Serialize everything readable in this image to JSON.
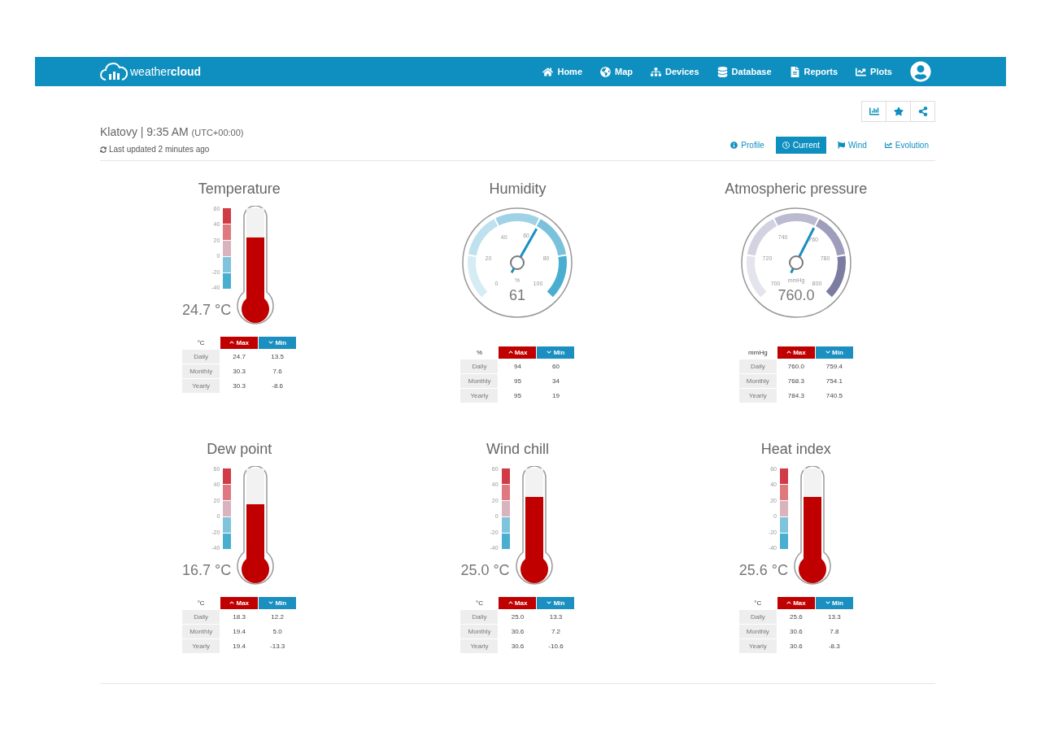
{
  "navbar": {
    "logo": "weather**cloud**",
    "items": [
      {
        "kind": "home",
        "label": "Home"
      },
      {
        "kind": "map",
        "label": "Map"
      },
      {
        "kind": "devices",
        "label": "Devices"
      },
      {
        "kind": "database",
        "label": "Database"
      },
      {
        "kind": "reports",
        "label": "Reports"
      },
      {
        "kind": "plots",
        "label": "Plots"
      }
    ]
  },
  "header": {
    "station": "Klatovy | 9:35 AM",
    "timezone": "(UTC+00:00)",
    "updated": "Last updated 2 minutes ago"
  },
  "toolbar": [
    {
      "kind": "chart"
    },
    {
      "kind": "star"
    },
    {
      "kind": "share"
    }
  ],
  "tabs": [
    {
      "kind": "info",
      "label": "Profile",
      "selected": false
    },
    {
      "kind": "clock",
      "label": "Current",
      "selected": true
    },
    {
      "kind": "flag",
      "label": "Wind",
      "selected": false
    },
    {
      "kind": "chart",
      "label": "Evolution",
      "selected": false
    }
  ],
  "widgets": [
    {
      "kind": "thermometer",
      "title": "Temperature",
      "scale": [
        "60",
        "40",
        "20",
        "0",
        "-20",
        "-40"
      ],
      "level": 0.647,
      "value": "24.7 °C",
      "unit": "°C",
      "max_label": "Max",
      "min_label": "Min",
      "rows": [
        {
          "period": "Daily",
          "max": "24.7",
          "min": "13.5"
        },
        {
          "period": "Monthly",
          "max": "30.3",
          "min": "7.6"
        },
        {
          "period": "Yearly",
          "max": "30.3",
          "min": "-8.6"
        }
      ]
    },
    {
      "kind": "gauge",
      "title": "Humidity",
      "scale": [
        "0",
        "20",
        "40",
        "60",
        "80",
        "100"
      ],
      "level": 0.61,
      "gauge_unit": "%",
      "value": "61",
      "unit": "%",
      "max_label": "Max",
      "min_label": "Min",
      "rows": [
        {
          "period": "Daily",
          "max": "94",
          "min": "60"
        },
        {
          "period": "Monthly",
          "max": "95",
          "min": "34"
        },
        {
          "period": "Yearly",
          "max": "95",
          "min": "19"
        }
      ]
    },
    {
      "kind": "gauge",
      "title": "Atmospheric pressure",
      "scale": [
        "700",
        "720",
        "740",
        "760",
        "780",
        "800"
      ],
      "level": 0.6,
      "gauge_unit": "mmHg",
      "value": "760.0",
      "unit": "mmHg",
      "max_label": "Max",
      "min_label": "Min",
      "rows": [
        {
          "period": "Daily",
          "max": "760.0",
          "min": "759.4"
        },
        {
          "period": "Monthly",
          "max": "768.3",
          "min": "754.1"
        },
        {
          "period": "Yearly",
          "max": "784.3",
          "min": "740.5"
        }
      ]
    },
    {
      "kind": "thermometer",
      "title": "Dew point",
      "scale": [
        "60",
        "40",
        "20",
        "0",
        "-20",
        "-40"
      ],
      "level": 0.567,
      "value": "16.7 °C",
      "unit": "°C",
      "max_label": "Max",
      "min_label": "Min",
      "rows": [
        {
          "period": "Daily",
          "max": "18.3",
          "min": "12.2"
        },
        {
          "period": "Monthly",
          "max": "19.4",
          "min": "5.0"
        },
        {
          "period": "Yearly",
          "max": "19.4",
          "min": "-13.3"
        }
      ]
    },
    {
      "kind": "thermometer",
      "title": "Wind chill",
      "scale": [
        "60",
        "40",
        "20",
        "0",
        "-20",
        "-40"
      ],
      "level": 0.65,
      "value": "25.0 °C",
      "unit": "°C",
      "max_label": "Max",
      "min_label": "Min",
      "rows": [
        {
          "period": "Daily",
          "max": "25.0",
          "min": "13.3"
        },
        {
          "period": "Monthly",
          "max": "30.6",
          "min": "7.2"
        },
        {
          "period": "Yearly",
          "max": "30.6",
          "min": "-10.6"
        }
      ]
    },
    {
      "kind": "thermometer",
      "title": "Heat index",
      "scale": [
        "60",
        "40",
        "20",
        "0",
        "-20",
        "-40"
      ],
      "level": 0.656,
      "value": "25.6 °C",
      "unit": "°C",
      "max_label": "Max",
      "min_label": "Min",
      "rows": [
        {
          "period": "Daily",
          "max": "25.6",
          "min": "13.3"
        },
        {
          "period": "Monthly",
          "max": "30.6",
          "min": "7.8"
        },
        {
          "period": "Yearly",
          "max": "30.6",
          "min": "-8.3"
        }
      ]
    }
  ]
}
